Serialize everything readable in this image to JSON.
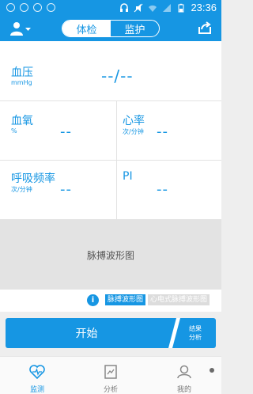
{
  "status_bar": {
    "time": "23:36"
  },
  "header": {
    "tabs": [
      {
        "label": "体检"
      },
      {
        "label": "监护"
      }
    ],
    "active_tab": "体检"
  },
  "measurements": {
    "blood_pressure": {
      "label": "血压",
      "unit": "mmHg",
      "value": "--/--"
    },
    "spo2": {
      "label": "血氧",
      "unit": "%",
      "value": "--"
    },
    "heart_rate": {
      "label": "心率",
      "unit": "次/分钟",
      "value": "--"
    },
    "respiration": {
      "label": "呼吸频率",
      "unit": "次/分钟",
      "value": "--"
    },
    "pi": {
      "label": "PI",
      "value": "--"
    }
  },
  "waveform": {
    "placeholder": "脉搏波形图"
  },
  "wave_toggle": {
    "options": [
      "脉搏波形图",
      "心电式脉搏波形图"
    ],
    "selected": "脉搏波形图"
  },
  "actions": {
    "start": "开始",
    "result_line1": "结果",
    "result_line2": "分析"
  },
  "bottom_nav": [
    {
      "label": "监测",
      "active": true
    },
    {
      "label": "分析",
      "active": false
    },
    {
      "label": "我的",
      "active": false
    }
  ],
  "colors": {
    "primary": "#1696e3",
    "divider": "#e3e3e3",
    "wave_bg": "#e3e3e3"
  }
}
